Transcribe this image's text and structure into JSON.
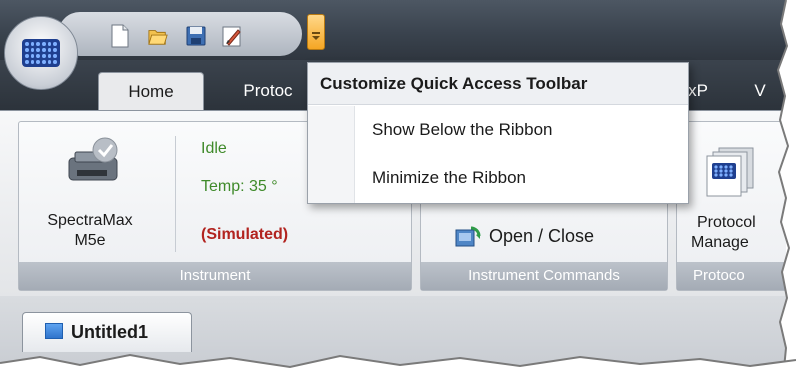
{
  "ribbon_tabs": [
    {
      "label": "Home",
      "active": true
    },
    {
      "label": "Protoc",
      "active": false
    },
    {
      "label": "xP",
      "active": false
    },
    {
      "label": "V",
      "active": false
    }
  ],
  "qat_menu": {
    "title": "Customize Quick Access Toolbar",
    "items": [
      "Show Below the Ribbon",
      "Minimize the Ribbon"
    ]
  },
  "instrument_group": {
    "device_name": "SpectraMax",
    "device_model": "M5e",
    "status_idle": "Idle",
    "status_temp": "Temp: 35 °",
    "status_mode": "(Simulated)",
    "group_label": "Instrument"
  },
  "instrument_commands_group": {
    "open_close_label": "Open / Close",
    "group_label": "Instrument Commands"
  },
  "protocol_group": {
    "manager_line1": "Protocol",
    "manager_line2": "Manage",
    "group_label": "Protoco"
  },
  "document_tab": {
    "label": "Untitled1"
  },
  "colors": {
    "status_green": "#3f8a2a",
    "status_red": "#b2231f",
    "title_bar": "#3a434e",
    "qat_dropdown_accent": "#f5a623"
  },
  "icons": [
    "app-logo-microplate",
    "new-document-icon",
    "open-folder-icon",
    "save-icon",
    "edit-icon",
    "qat-dropdown-icon",
    "plate-reader-icon",
    "check-badge-icon",
    "open-close-icon",
    "protocol-manager-icon",
    "document-icon"
  ]
}
